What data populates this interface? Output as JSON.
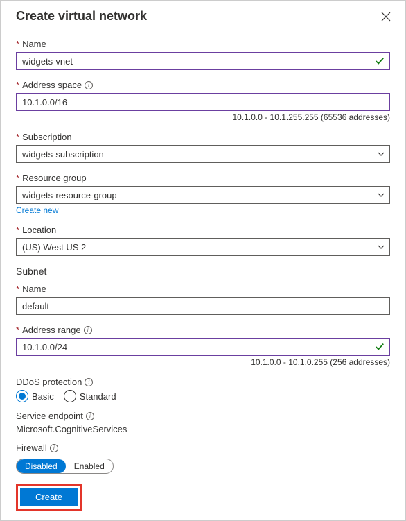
{
  "header": {
    "title": "Create virtual network"
  },
  "name": {
    "label": "Name",
    "value": "widgets-vnet"
  },
  "address_space": {
    "label": "Address space",
    "value": "10.1.0.0/16",
    "hint": "10.1.0.0 - 10.1.255.255 (65536 addresses)"
  },
  "subscription": {
    "label": "Subscription",
    "value": "widgets-subscription"
  },
  "resource_group": {
    "label": "Resource group",
    "value": "widgets-resource-group",
    "create_link": "Create new"
  },
  "location": {
    "label": "Location",
    "value": "(US) West US 2"
  },
  "subnet": {
    "heading": "Subnet",
    "name": {
      "label": "Name",
      "value": "default"
    },
    "range": {
      "label": "Address range",
      "value": "10.1.0.0/24",
      "hint": "10.1.0.0 - 10.1.0.255 (256 addresses)"
    }
  },
  "ddos": {
    "label": "DDoS protection",
    "options": {
      "basic": "Basic",
      "standard": "Standard"
    }
  },
  "service_endpoint": {
    "label": "Service endpoint",
    "value": "Microsoft.CognitiveServices"
  },
  "firewall": {
    "label": "Firewall",
    "options": {
      "disabled": "Disabled",
      "enabled": "Enabled"
    }
  },
  "footer": {
    "create": "Create"
  }
}
